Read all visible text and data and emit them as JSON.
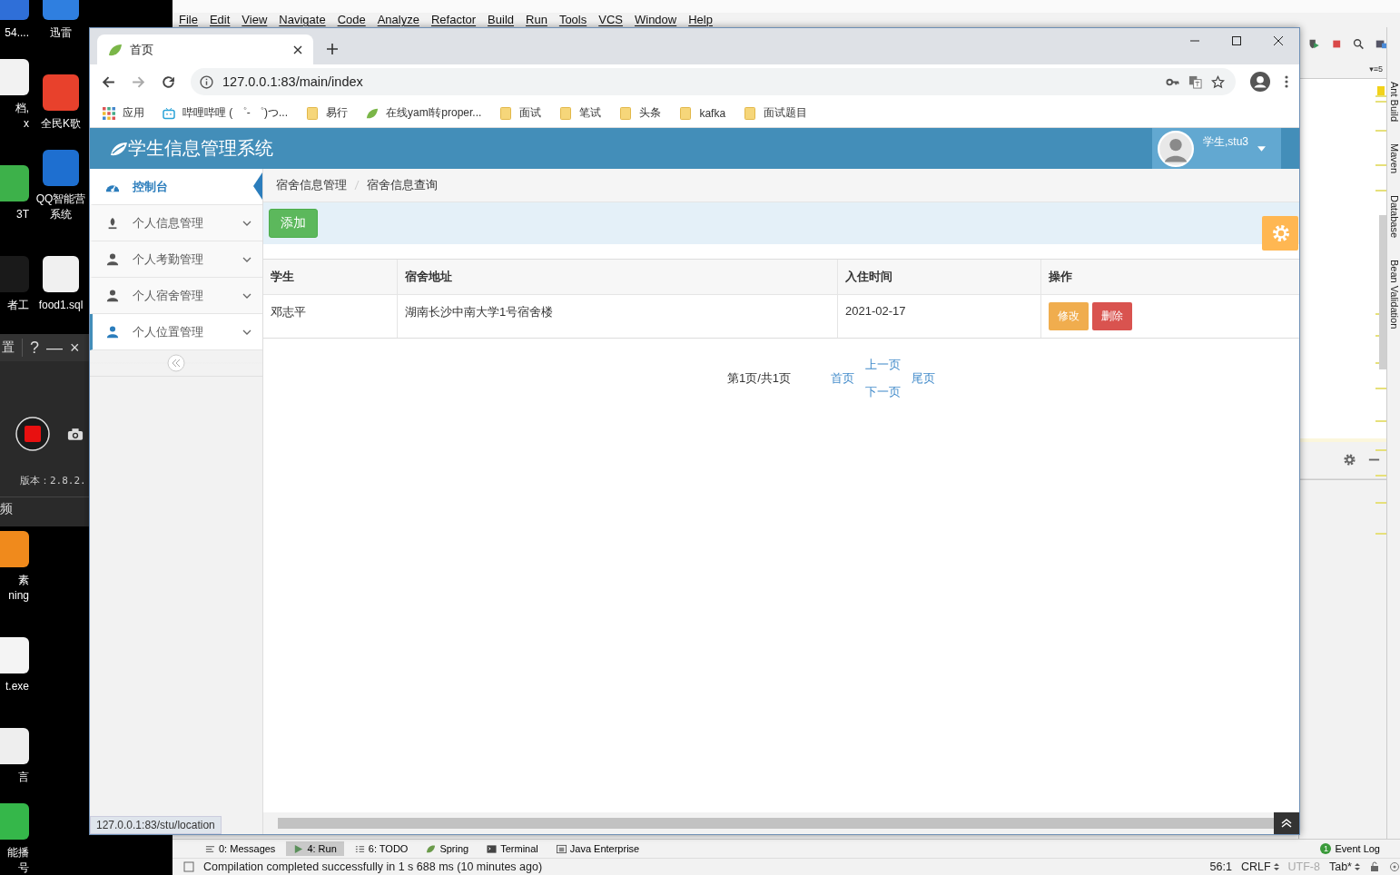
{
  "desktop": {
    "left_top": [
      {
        "lines": [
          "54...."
        ],
        "color": "#2f6fd8"
      },
      {
        "lines": [
          "档,",
          "x"
        ],
        "color": "#f2f2f2"
      },
      {
        "lines": [
          "3T"
        ],
        "color": "#3db14a"
      },
      {
        "lines": [
          "者工"
        ],
        "color": "#1a1a1a"
      }
    ],
    "left_bottom": [
      {
        "lines": [
          "素",
          "ning"
        ],
        "color": "#f08a1c"
      },
      {
        "lines": [
          "t.exe"
        ],
        "color": "#f4f4f4"
      },
      {
        "lines": [
          "言"
        ],
        "color": "#eeeeee"
      },
      {
        "lines": [
          "能播",
          "号"
        ],
        "color": "#35b74a"
      }
    ],
    "right": [
      {
        "lines": [
          "迅雷"
        ],
        "color": "#2f7fe0"
      },
      {
        "lines": [
          "全民K歌"
        ],
        "color": "#e8412c"
      },
      {
        "lines": [
          "QQ智能营",
          "系统"
        ],
        "color": "#1e6fd0"
      },
      {
        "lines": [
          "food1.sql"
        ],
        "color": "#f0f0f0"
      }
    ]
  },
  "recorder": {
    "menu": "置",
    "help": "?",
    "minimize": "—",
    "close": "×",
    "version": "版本：2.8.2.",
    "tab": "频"
  },
  "ide": {
    "menu": [
      "File",
      "Edit",
      "View",
      "Navigate",
      "Code",
      "Analyze",
      "Refactor",
      "Build",
      "Run",
      "Tools",
      "VCS",
      "Window",
      "Help"
    ],
    "tool_label": "▾≡5",
    "side_tools": [
      "Ant Build",
      "Maven",
      "Database",
      "Bean Validation"
    ],
    "tool_tabs": [
      {
        "label": "0: Messages",
        "kind": "messages",
        "selected": false
      },
      {
        "label": "4: Run",
        "kind": "run",
        "selected": true
      },
      {
        "label": "6: TODO",
        "kind": "todo",
        "selected": false
      },
      {
        "label": "Spring",
        "kind": "spring",
        "selected": false
      },
      {
        "label": "Terminal",
        "kind": "terminal",
        "selected": false
      },
      {
        "label": "Java Enterprise",
        "kind": "enterprise",
        "selected": false
      }
    ],
    "event_log": {
      "badge": "1",
      "label": "Event Log"
    },
    "status": {
      "message": "Compilation completed successfully in 1 s 688 ms (10 minutes ago)",
      "items": [
        {
          "label": "56:1",
          "disabled": false,
          "dropdown": false
        },
        {
          "label": "CRLF",
          "disabled": false,
          "dropdown": true
        },
        {
          "label": "UTF-8",
          "disabled": true,
          "dropdown": false
        },
        {
          "label": "Tab*",
          "disabled": false,
          "dropdown": true
        }
      ]
    }
  },
  "browser": {
    "tabs": [
      {
        "title": "首页",
        "selected": true
      }
    ],
    "url": "127.0.0.1:83/main/index",
    "bookmarks": [
      {
        "label": "应用",
        "kind": "apps"
      },
      {
        "label": "哔哩哔哩 ( ゜- ゜)つ...",
        "kind": "tv"
      },
      {
        "label": "易行",
        "kind": "folder"
      },
      {
        "label": "在线yaml转proper...",
        "kind": "leaf"
      },
      {
        "label": "面试",
        "kind": "folder"
      },
      {
        "label": "笔试",
        "kind": "folder"
      },
      {
        "label": "头条",
        "kind": "folder"
      },
      {
        "label": "kafka",
        "kind": "folder"
      },
      {
        "label": "面试题目",
        "kind": "folder"
      }
    ],
    "status_url": "127.0.0.1:83/stu/location"
  },
  "app": {
    "title": "学生信息管理系统",
    "user": "学生,stu3",
    "sidebar": [
      {
        "label": "控制台",
        "kind": "dashboard",
        "selected": true,
        "hovered": false,
        "expandable": false
      },
      {
        "label": "个人信息管理",
        "kind": "pencil",
        "selected": false,
        "hovered": false,
        "expandable": true
      },
      {
        "label": "个人考勤管理",
        "kind": "user",
        "selected": false,
        "hovered": false,
        "expandable": true
      },
      {
        "label": "个人宿舍管理",
        "kind": "user",
        "selected": false,
        "hovered": false,
        "expandable": true
      },
      {
        "label": "个人位置管理",
        "kind": "user",
        "selected": false,
        "hovered": true,
        "expandable": true
      }
    ],
    "breadcrumb": [
      "宿舍信息管理",
      "宿舍信息查询"
    ],
    "add_button": "添加",
    "table": {
      "columns": [
        "学生",
        "宿舍地址",
        "入住时间",
        "操作"
      ],
      "rows": [
        {
          "cells": [
            "邓志平",
            "湖南长沙中南大学1号宿舍楼",
            "2021-02-17"
          ],
          "actions": [
            {
              "label": "修改",
              "kind": "edit"
            },
            {
              "label": "删除",
              "kind": "delete"
            }
          ]
        }
      ]
    },
    "pagination": {
      "info": "第1页/共1页",
      "first": "首页",
      "prev": "上一页",
      "next": "下一页",
      "last": "尾页"
    }
  }
}
